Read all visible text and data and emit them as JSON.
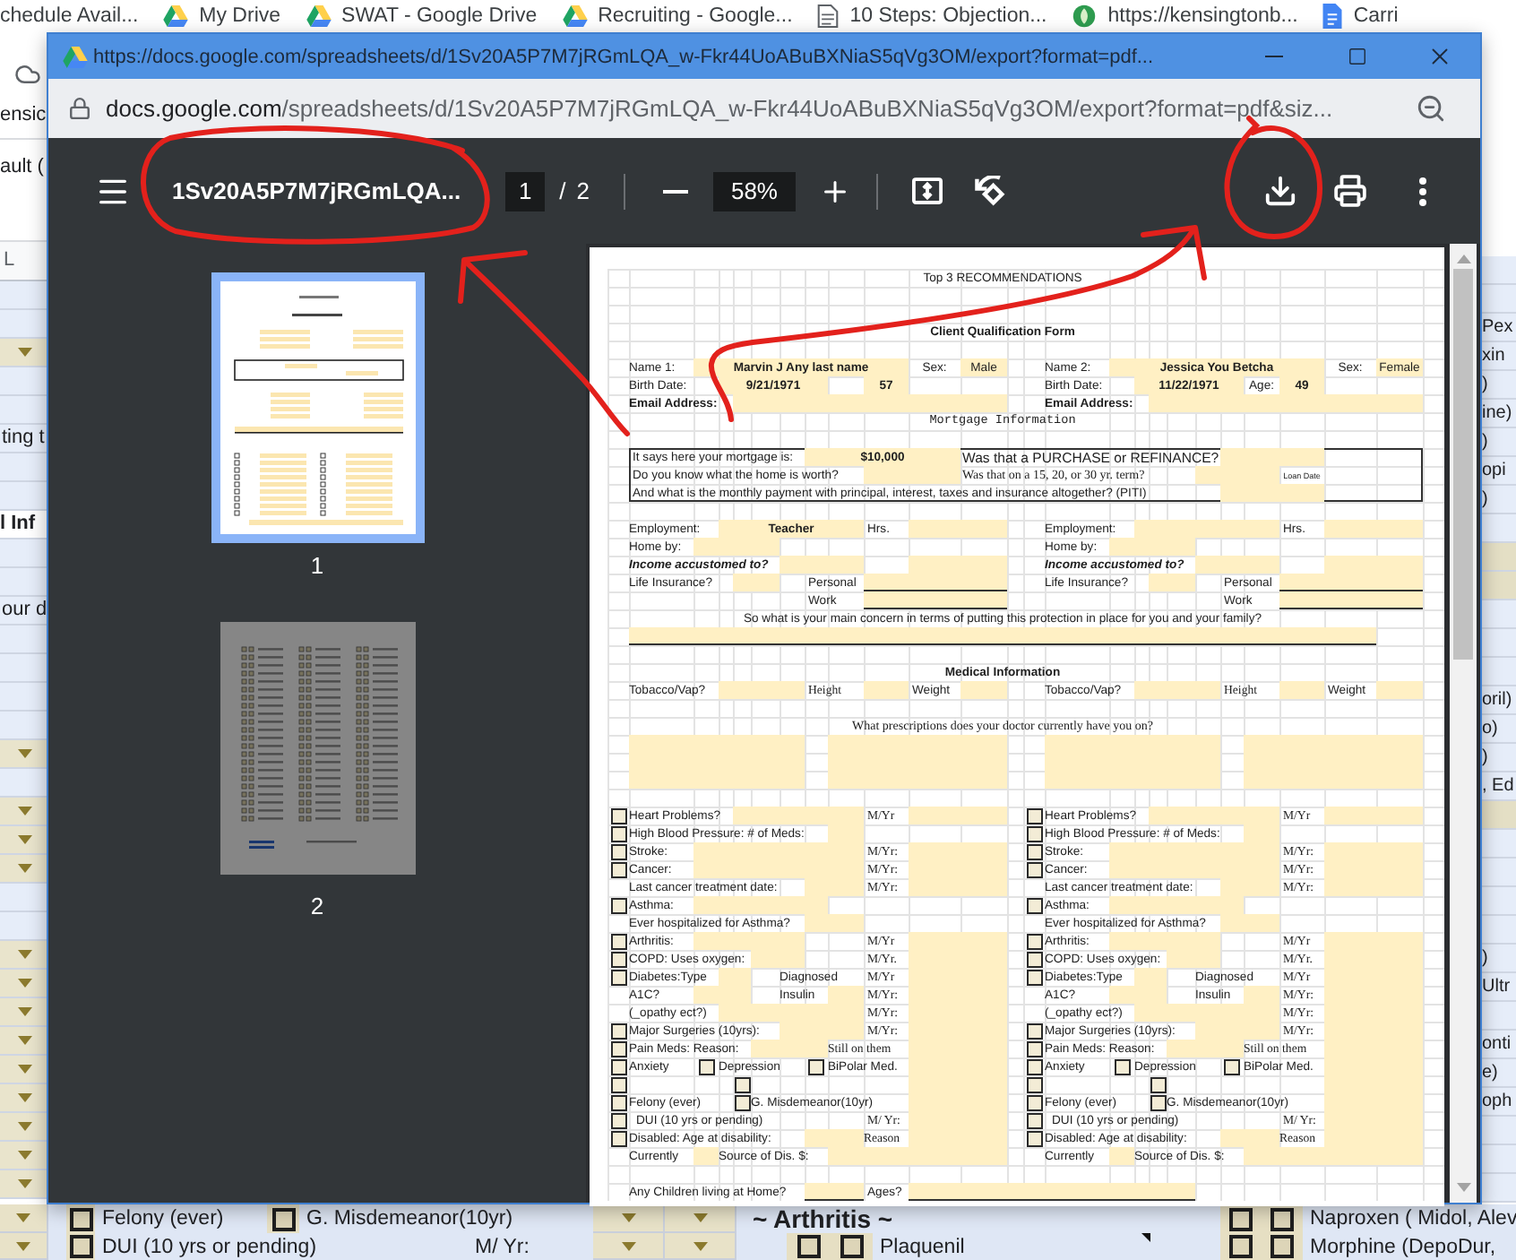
{
  "bookmarks_bar": {
    "items": [
      {
        "title": "chedule Avail...",
        "kind": "plain"
      },
      {
        "title": "My Drive",
        "kind": "drive"
      },
      {
        "title": "SWAT - Google Drive",
        "kind": "drive"
      },
      {
        "title": "Recruiting - Google...",
        "kind": "drive"
      },
      {
        "title": "10 Steps: Objection...",
        "kind": "page"
      },
      {
        "title": "https://kensingtonb...",
        "kind": "site"
      },
      {
        "title": "Carri",
        "kind": "docs"
      }
    ]
  },
  "background_sheet": {
    "top_fragments": [
      "ensic",
      "ault ("
    ],
    "column_header": "L",
    "left_rows": [
      {
        "kind": "empty"
      },
      {
        "kind": "empty"
      },
      {
        "kind": "dropdown"
      },
      {
        "kind": "empty"
      },
      {
        "kind": "empty"
      },
      {
        "kind": "text",
        "text": "ting t"
      },
      {
        "kind": "empty"
      },
      {
        "kind": "empty"
      },
      {
        "kind": "heading",
        "text": "l Inf"
      },
      {
        "kind": "empty"
      },
      {
        "kind": "empty"
      },
      {
        "kind": "text",
        "text": "our d"
      },
      {
        "kind": "empty"
      },
      {
        "kind": "empty"
      },
      {
        "kind": "empty"
      },
      {
        "kind": "empty"
      },
      {
        "kind": "dropdown"
      },
      {
        "kind": "empty"
      },
      {
        "kind": "dropdown"
      },
      {
        "kind": "dropdown"
      },
      {
        "kind": "dropdown"
      },
      {
        "kind": "empty"
      },
      {
        "kind": "empty"
      },
      {
        "kind": "dropdown"
      },
      {
        "kind": "dropdown"
      },
      {
        "kind": "dropdown"
      },
      {
        "kind": "dropdown"
      },
      {
        "kind": "dropdown"
      },
      {
        "kind": "dropdown"
      },
      {
        "kind": "dropdown"
      },
      {
        "kind": "dropdown"
      },
      {
        "kind": "dropdown"
      }
    ],
    "right_rows": [
      {
        "kind": "empty"
      },
      {
        "kind": "empty"
      },
      {
        "kind": "text",
        "text": "Pex"
      },
      {
        "kind": "text",
        "text": "xin"
      },
      {
        "kind": "text",
        "text": ")"
      },
      {
        "kind": "text",
        "text": "ine)"
      },
      {
        "kind": "text",
        "text": ")"
      },
      {
        "kind": "text",
        "text": "opi"
      },
      {
        "kind": "text",
        "text": ")"
      },
      {
        "kind": "empty"
      },
      {
        "kind": "band"
      },
      {
        "kind": "band"
      },
      {
        "kind": "empty"
      },
      {
        "kind": "empty"
      },
      {
        "kind": "empty"
      },
      {
        "kind": "text",
        "text": "oril)"
      },
      {
        "kind": "text",
        "text": "o)"
      },
      {
        "kind": "text",
        "text": ")"
      },
      {
        "kind": "text",
        "text": ", Ed"
      },
      {
        "kind": "band"
      },
      {
        "kind": "empty"
      },
      {
        "kind": "empty"
      },
      {
        "kind": "empty"
      },
      {
        "kind": "empty"
      },
      {
        "kind": "text",
        "text": ")"
      },
      {
        "kind": "text",
        "text": "Ultr"
      },
      {
        "kind": "empty"
      },
      {
        "kind": "text",
        "text": "onti"
      },
      {
        "kind": "text",
        "text": "e)"
      },
      {
        "kind": "text",
        "text": "oph"
      },
      {
        "kind": "empty"
      },
      {
        "kind": "empty"
      },
      {
        "kind": "empty"
      }
    ],
    "bottom_rows": [
      {
        "cells": [
          {
            "kind": "dropdown"
          },
          {
            "kind": "checkbox",
            "checked": false
          },
          {
            "kind": "text",
            "text": "Felony (ever)"
          },
          {
            "kind": "checkbox",
            "checked": false
          },
          {
            "kind": "text",
            "text": "G. Misdemeanor(10yr)"
          },
          {
            "kind": "dropdown"
          },
          {
            "kind": "dropdown"
          },
          {
            "kind": "heading",
            "text": "~ Arthritis ~"
          },
          {
            "kind": "checkbox",
            "checked": false
          },
          {
            "kind": "checkbox",
            "checked": false
          },
          {
            "kind": "text",
            "text": "Naproxen ( Midol, Alev"
          }
        ]
      },
      {
        "cells": [
          {
            "kind": "dropdown"
          },
          {
            "kind": "checkbox",
            "checked": false
          },
          {
            "kind": "text",
            "text": "DUI (10 yrs or pending)"
          },
          {
            "kind": "text",
            "text": "M/ Yr:"
          },
          {
            "kind": "dropdown"
          },
          {
            "kind": "dropdown"
          },
          {
            "kind": "checkbox",
            "checked": false
          },
          {
            "kind": "checkbox",
            "checked": false
          },
          {
            "kind": "text",
            "text": "Plaquenil"
          },
          {
            "kind": "comment_marker"
          },
          {
            "kind": "checkbox",
            "checked": false
          },
          {
            "kind": "checkbox",
            "checked": false
          },
          {
            "kind": "text",
            "text": "Morphine (DepoDur,"
          }
        ]
      }
    ]
  },
  "popup": {
    "title": "https://docs.google.com/spreadsheets/d/1Sv20A5P7M7jRGmLQA_w-Fkr44UoABuBXNiaS5qVg3OM/export?format=pdf...",
    "address_host": "docs.google.com",
    "address_path": "/spreadsheets/d/1Sv20A5P7M7jRGmLQA_w-Fkr44UoABuBXNiaS5qVg3OM/export?format=pdf&siz..."
  },
  "pdf_viewer": {
    "title": "1Sv20A5P7M7jRGmLQA...",
    "current_page": "1",
    "page_separator": "/",
    "page_count": "2",
    "zoom": "58%",
    "thumbnails": [
      {
        "label": "1",
        "selected": true
      },
      {
        "label": "2",
        "selected": false
      }
    ]
  },
  "pdf_page": {
    "heading": "Top 3 RECOMMENDATIONS",
    "form_title": "Client Qualification Form",
    "mortgage_heading": "Mortgage Information",
    "mortgage_questions": [
      {
        "question": "It says here your mortgage is:",
        "answer": "$10,000",
        "follow_up": "Was that a PURCHASE or REFINANCE?"
      },
      {
        "question": "Do you know what the home is worth?",
        "follow_up": "Was that on a 15, 20, or 30 yr. term?",
        "note": "Loan Date"
      },
      {
        "question": "And what is the monthly payment with principal, interest, taxes and insurance altogether? (PITI)"
      }
    ],
    "concern_question": "So what is your main concern in terms of putting this protection in place for you and your family?",
    "medical_heading": "Medical Information",
    "prescriptions_question": "What prescriptions does your doctor currently have you on?",
    "children_question": "Any Children living at Home?",
    "ages_label": "Ages?",
    "clients": [
      {
        "name_label": "Name 1:",
        "name": "Marvin J Any last name",
        "sex_label": "Sex:",
        "sex": "Male",
        "birth_date_label": "Birth Date:",
        "birth_date": "9/21/1971",
        "age": "57",
        "email_label": "Email Address:",
        "employment_label": "Employment:",
        "employment": "Teacher",
        "hours_label": "Hrs.",
        "home_by_label": "Home by:",
        "income_label": "Income accustomed to?",
        "life_insurance_label": "Life Insurance?",
        "personal_label": "Personal",
        "work_label": "Work",
        "tobacco_label": "Tobacco/Vap?",
        "height_label": "Height",
        "weight_label": "Weight",
        "conditions": [
          {
            "kind": "check",
            "checked": false,
            "label": "Heart Problems?",
            "unit": "M/Yr"
          },
          {
            "kind": "check",
            "checked": false,
            "label": "High Blood Pressure: # of Meds:"
          },
          {
            "kind": "check",
            "checked": false,
            "label": "Stroke:",
            "unit": "M/Yr:"
          },
          {
            "kind": "check",
            "checked": false,
            "label": "Cancer:",
            "unit": "M/Yr:"
          },
          {
            "kind": "plain",
            "label": "Last cancer treatment date:",
            "unit": "M/Yr:"
          },
          {
            "kind": "check",
            "checked": false,
            "label": "Asthma:"
          },
          {
            "kind": "plain",
            "label": "Ever hospitalized for Asthma?"
          },
          {
            "kind": "check",
            "checked": false,
            "label": "Arthritis:",
            "unit": "M/Yr"
          },
          {
            "kind": "check",
            "checked": false,
            "label": "COPD: Uses oxygen:",
            "unit": "M/Yr."
          },
          {
            "kind": "check",
            "checked": false,
            "label": "Diabetes:Type",
            "extra": "Diagnosed",
            "unit": "M/Yr"
          },
          {
            "kind": "plain",
            "label": "A1C?",
            "extra": "Insulin",
            "unit": "M/Yr:"
          },
          {
            "kind": "plain",
            "label": "(_opathy ect?)",
            "unit": "M/Yr:"
          },
          {
            "kind": "check",
            "checked": false,
            "label": "Major Surgeries (10yrs):",
            "unit": "M/Yr:"
          },
          {
            "kind": "check",
            "checked": false,
            "label": "Pain Meds: Reason:",
            "extra": "Still on them"
          },
          {
            "kind": "multi",
            "items": [
              {
                "checked": false,
                "label": "Anxiety"
              },
              {
                "checked": false,
                "label": "Depression"
              },
              {
                "checked": false,
                "label": "BiPolar Med."
              }
            ]
          },
          {
            "kind": "multi",
            "items": [
              {
                "checked": false
              },
              {
                "checked": false
              }
            ]
          },
          {
            "kind": "multi",
            "items": [
              {
                "checked": false,
                "label": "Felony (ever)"
              },
              {
                "checked": false,
                "label": "G. Misdemeanor(10yr)"
              }
            ]
          },
          {
            "kind": "check",
            "checked": false,
            "label": "DUI (10 yrs or pending)",
            "unit": "M/ Yr:"
          },
          {
            "kind": "check",
            "checked": false,
            "label": "Disabled: Age at disability:",
            "extra": "Reason"
          },
          {
            "kind": "plain",
            "label": "Currently",
            "extra": "Source of Dis. $:"
          }
        ]
      },
      {
        "name_label": "Name 2:",
        "name": "Jessica You Betcha",
        "sex_label": "Sex:",
        "sex": "Female",
        "birth_date_label": "Birth Date:",
        "birth_date": "11/22/1971",
        "age_label": "Age:",
        "age": "49",
        "email_label": "Email Address:",
        "employment_label": "Employment:",
        "hours_label": "Hrs.",
        "home_by_label": "Home by:",
        "income_label": "Income accustomed to?",
        "life_insurance_label": "Life Insurance?",
        "personal_label": "Personal",
        "work_label": "Work",
        "tobacco_label": "Tobacco/Vap?",
        "height_label": "Height",
        "weight_label": "Weight",
        "conditions": [
          {
            "kind": "check",
            "checked": false,
            "label": "Heart Problems?",
            "unit": "M/Yr"
          },
          {
            "kind": "check",
            "checked": false,
            "label": "High Blood Pressure: # of Meds:"
          },
          {
            "kind": "check",
            "checked": false,
            "label": "Stroke:",
            "unit": "M/Yr:"
          },
          {
            "kind": "check",
            "checked": false,
            "label": "Cancer:",
            "unit": "M/Yr:"
          },
          {
            "kind": "plain",
            "label": "Last cancer treatment date:",
            "unit": "M/Yr:"
          },
          {
            "kind": "check",
            "checked": false,
            "label": "Asthma:"
          },
          {
            "kind": "plain",
            "label": "Ever hospitalized for Asthma?"
          },
          {
            "kind": "check",
            "checked": false,
            "label": "Arthritis:",
            "unit": "M/Yr"
          },
          {
            "kind": "check",
            "checked": false,
            "label": "COPD: Uses oxygen:",
            "unit": "M/Yr."
          },
          {
            "kind": "check",
            "checked": false,
            "label": "Diabetes:Type",
            "extra": "Diagnosed",
            "unit": "M/Yr"
          },
          {
            "kind": "plain",
            "label": "A1C?",
            "extra": "Insulin",
            "unit": "M/Yr:"
          },
          {
            "kind": "plain",
            "label": "(_opathy ect?)",
            "unit": "M/Yr:"
          },
          {
            "kind": "check",
            "checked": false,
            "label": "Major Surgeries (10yrs):",
            "unit": "M/Yr:"
          },
          {
            "kind": "check",
            "checked": false,
            "label": "Pain Meds: Reason:",
            "extra": "Still on them"
          },
          {
            "kind": "multi",
            "items": [
              {
                "checked": false,
                "label": "Anxiety"
              },
              {
                "checked": false,
                "label": "Depression"
              },
              {
                "checked": false,
                "label": "BiPolar Med."
              }
            ]
          },
          {
            "kind": "multi",
            "items": [
              {
                "checked": false
              },
              {
                "checked": false
              }
            ]
          },
          {
            "kind": "multi",
            "items": [
              {
                "checked": false,
                "label": "Felony (ever)"
              },
              {
                "checked": false,
                "label": "G. Misdemeanor(10yr)"
              }
            ]
          },
          {
            "kind": "check",
            "checked": false,
            "label": "DUI (10 yrs or pending)",
            "unit": "M/ Yr:"
          },
          {
            "kind": "check",
            "checked": false,
            "label": "Disabled: Age at disability:",
            "extra": "Reason"
          },
          {
            "kind": "plain",
            "label": "Currently",
            "extra": "Source of Dis. $:"
          }
        ]
      }
    ]
  },
  "annotations": [
    {
      "kind": "circle"
    },
    {
      "kind": "circle"
    },
    {
      "kind": "arrow"
    },
    {
      "kind": "arrow"
    }
  ]
}
